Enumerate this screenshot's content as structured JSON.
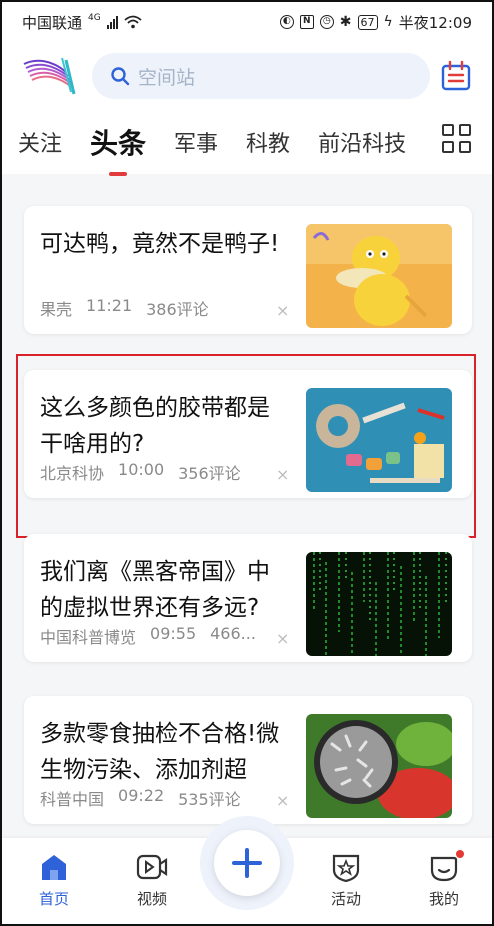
{
  "status_bar": {
    "carrier": "中国联通",
    "network": "4G",
    "battery": "67",
    "time": "半夜12:09"
  },
  "header": {
    "search_placeholder": "空间站"
  },
  "tabs": [
    {
      "label": "关注",
      "active": false
    },
    {
      "label": "头条",
      "active": true
    },
    {
      "label": "军事",
      "active": false
    },
    {
      "label": "科教",
      "active": false
    },
    {
      "label": "前沿科技",
      "active": false
    }
  ],
  "feed": [
    {
      "title": "可达鸭，竟然不是鸭子!",
      "source": "果壳",
      "time": "11:21",
      "comments": "386评论",
      "image": "psyduck-toy"
    },
    {
      "title": "这么多颜色的胶带都是干啥用的?",
      "source": "北京科协",
      "time": "10:00",
      "comments": "356评论",
      "image": "colorful-tapes"
    },
    {
      "title": "我们离《黑客帝国》中的虚拟世界还有多远?",
      "source": "中国科普博览",
      "time": "09:55",
      "comments": "466...",
      "image": "matrix-code"
    },
    {
      "title": "多款零食抽检不合格!微生物污染、添加剂超",
      "source": "科普中国",
      "time": "09:22",
      "comments": "535评论",
      "image": "microscope-food"
    }
  ],
  "close_glyph": "×",
  "bottom_nav": [
    {
      "label": "首页",
      "icon": "home-icon",
      "active": true
    },
    {
      "label": "视频",
      "icon": "video-icon",
      "active": false
    },
    {
      "label": "活动",
      "icon": "activity-icon",
      "active": false
    },
    {
      "label": "我的",
      "icon": "profile-icon",
      "active": false
    }
  ],
  "colors": {
    "accent": "#2e62d9",
    "tab_indicator": "#e23b3b",
    "highlight_box": "#d9232a",
    "badge": "#e53935"
  }
}
